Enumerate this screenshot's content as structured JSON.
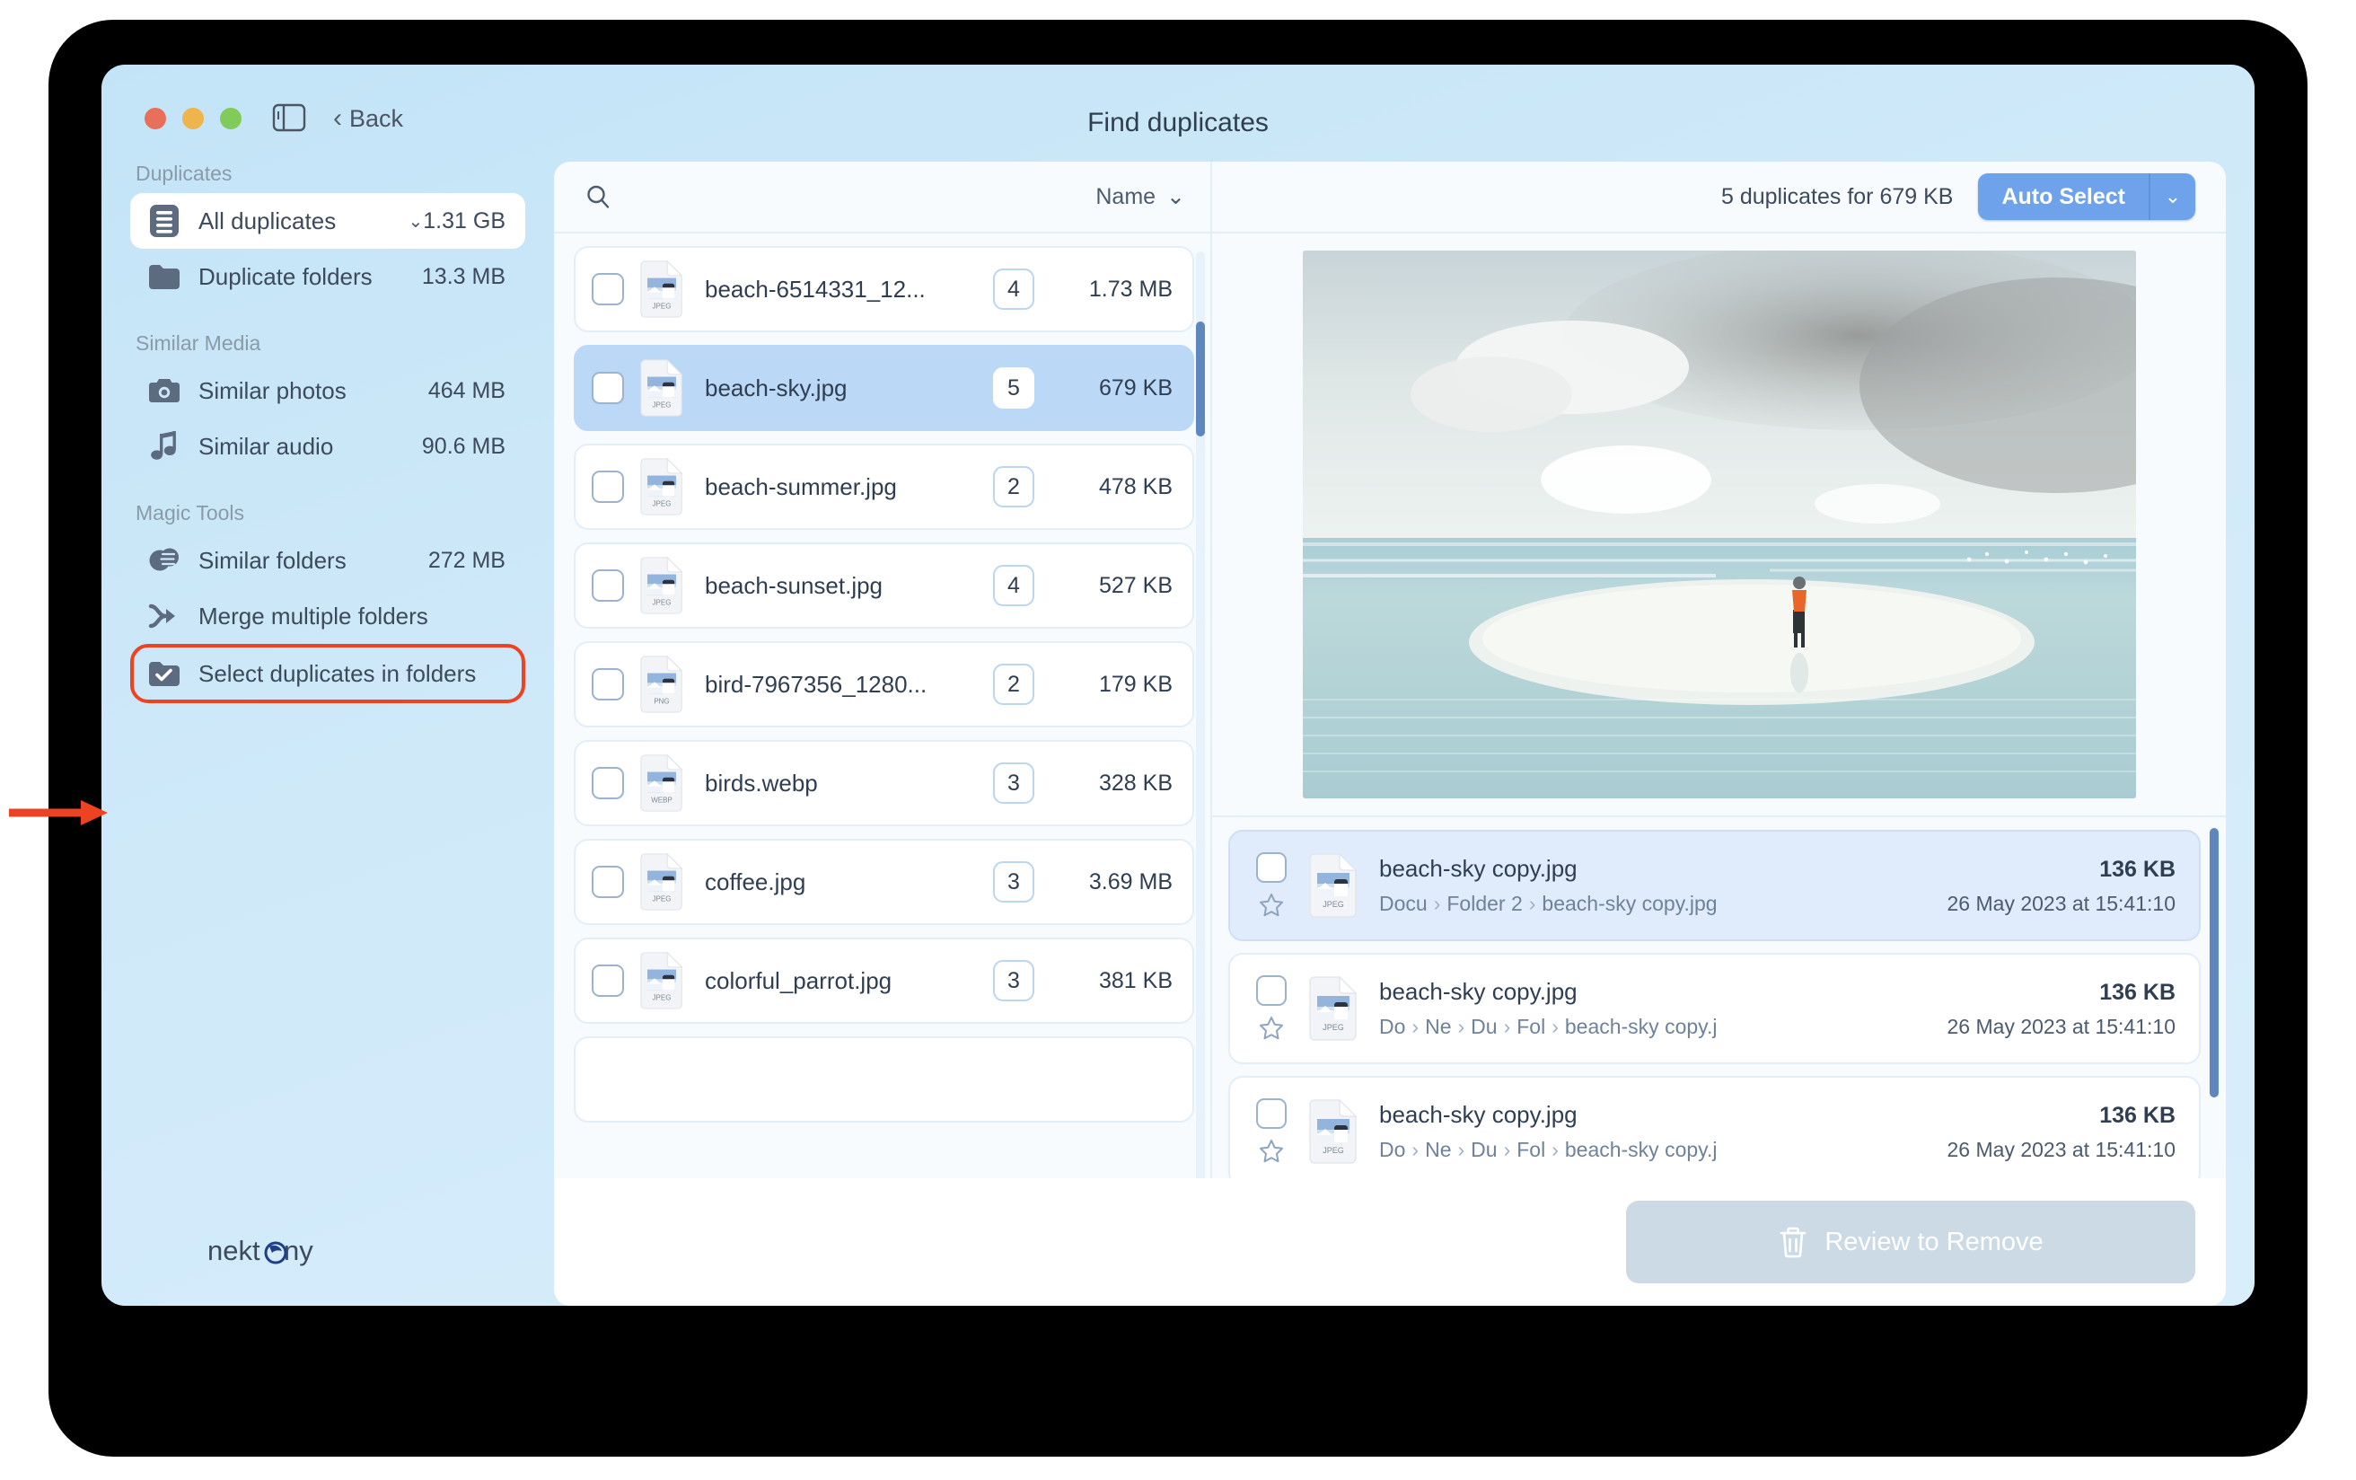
{
  "window": {
    "title": "Find duplicates",
    "back_label": "Back",
    "traffic_lights": [
      "close-red",
      "minimize-yellow",
      "zoom-green"
    ],
    "sidebar_toggle_icon": "sidebar-toggle-icon"
  },
  "sidebar": {
    "groups": [
      {
        "title": "Duplicates",
        "items": [
          {
            "icon": "document-lines-icon",
            "label": "All duplicates",
            "size": "1.31 GB",
            "active": true,
            "has_caret": true
          },
          {
            "icon": "folder-icon",
            "label": "Duplicate folders",
            "size": "13.3 MB",
            "active": false,
            "has_caret": false
          }
        ]
      },
      {
        "title": "Similar Media",
        "items": [
          {
            "icon": "camera-icon",
            "label": "Similar photos",
            "size": "464 MB",
            "active": false,
            "has_caret": false
          },
          {
            "icon": "music-note-icon",
            "label": "Similar audio",
            "size": "90.6 MB",
            "active": false,
            "has_caret": false
          }
        ]
      },
      {
        "title": "Magic Tools",
        "items": [
          {
            "icon": "overlapping-circles-icon",
            "label": "Similar folders",
            "size": "272 MB",
            "active": false,
            "has_caret": false
          },
          {
            "icon": "merge-arrow-icon",
            "label": "Merge multiple folders",
            "size": "",
            "active": false,
            "has_caret": false
          },
          {
            "icon": "folder-check-icon",
            "label": "Select duplicates in folders",
            "size": "",
            "active": false,
            "has_caret": false,
            "annotated": true
          }
        ]
      }
    ],
    "logo_text": "nektony"
  },
  "toolbar": {
    "search_placeholder": "",
    "search_value": "",
    "search_icon": "search-icon",
    "sort_label": "Name",
    "sort_caret_icon": "chevron-down-icon",
    "duplicates_summary": "5 duplicates for 679 KB",
    "auto_select_label": "Auto Select",
    "auto_select_caret_icon": "chevron-down-icon"
  },
  "file_list": [
    {
      "name": "beach-6514331_12...",
      "type": "JPEG",
      "count": "4",
      "size": "1.73 MB",
      "selected": false
    },
    {
      "name": "beach-sky.jpg",
      "type": "JPEG",
      "count": "5",
      "size": "679 KB",
      "selected": true
    },
    {
      "name": "beach-summer.jpg",
      "type": "JPEG",
      "count": "2",
      "size": "478 KB",
      "selected": false
    },
    {
      "name": "beach-sunset.jpg",
      "type": "JPEG",
      "count": "4",
      "size": "527 KB",
      "selected": false
    },
    {
      "name": "bird-7967356_1280...",
      "type": "PNG",
      "count": "2",
      "size": "179 KB",
      "selected": false
    },
    {
      "name": "birds.webp",
      "type": "WEBP",
      "count": "3",
      "size": "328 KB",
      "selected": false
    },
    {
      "name": "coffee.jpg",
      "type": "JPEG",
      "count": "3",
      "size": "3.69 MB",
      "selected": false
    },
    {
      "name": "colorful_parrot.jpg",
      "type": "JPEG",
      "count": "3",
      "size": "381 KB",
      "selected": false
    }
  ],
  "preview": {
    "alt": "beach scene with person walking on sandbar under clouds"
  },
  "duplicate_rows": [
    {
      "name": "beach-sky copy.jpg",
      "type": "JPEG",
      "size": "136 KB",
      "path": [
        "Docu",
        "Folder 2",
        "beach-sky copy.jpg"
      ],
      "date": "26 May 2023 at 15:41:10",
      "selected": true
    },
    {
      "name": "beach-sky copy.jpg",
      "type": "JPEG",
      "size": "136 KB",
      "path": [
        "Do",
        "Ne",
        "Du",
        "Fol",
        "beach-sky copy.j"
      ],
      "date": "26 May 2023 at 15:41:10",
      "selected": false
    },
    {
      "name": "beach-sky copy.jpg",
      "type": "JPEG",
      "size": "136 KB",
      "path": [
        "Do",
        "Ne",
        "Du",
        "Fol",
        "beach-sky copy.j"
      ],
      "date": "26 May 2023 at 15:41:10",
      "selected": false
    }
  ],
  "footer": {
    "review_label": "Review to Remove",
    "trash_icon": "trash-icon",
    "enabled": false
  },
  "colors": {
    "accent_blue": "#6ea2ea",
    "annotation_red": "#ee4323",
    "selected_row_blue": "#bcd8f7",
    "window_bg": "#cfe9f9"
  }
}
